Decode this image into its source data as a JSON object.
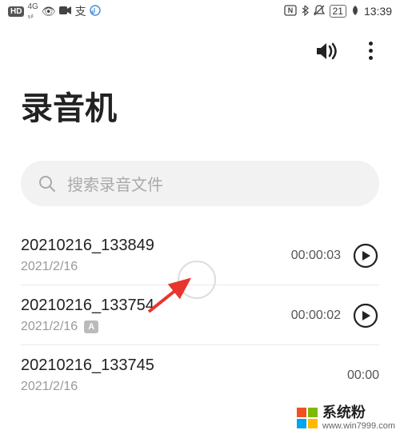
{
  "status_bar": {
    "hd": "HD",
    "signal": "4G",
    "signal_sub": "⁴ᴳ",
    "time": "13:39",
    "battery": "21",
    "nfc": "N",
    "bluetooth": "bt"
  },
  "header": {
    "title": "录音机"
  },
  "search": {
    "placeholder": "搜索录音文件"
  },
  "recordings": [
    {
      "name": "20210216_133849",
      "date": "2021/2/16",
      "duration": "00:00:03",
      "has_a_badge": false
    },
    {
      "name": "20210216_133754",
      "date": "2021/2/16",
      "duration": "00:00:02",
      "has_a_badge": true
    },
    {
      "name": "20210216_133745",
      "date": "2021/2/16",
      "duration": "00:00",
      "has_a_badge": false
    }
  ],
  "watermark": {
    "text": "系统粉",
    "url": "www.win7999.com"
  }
}
